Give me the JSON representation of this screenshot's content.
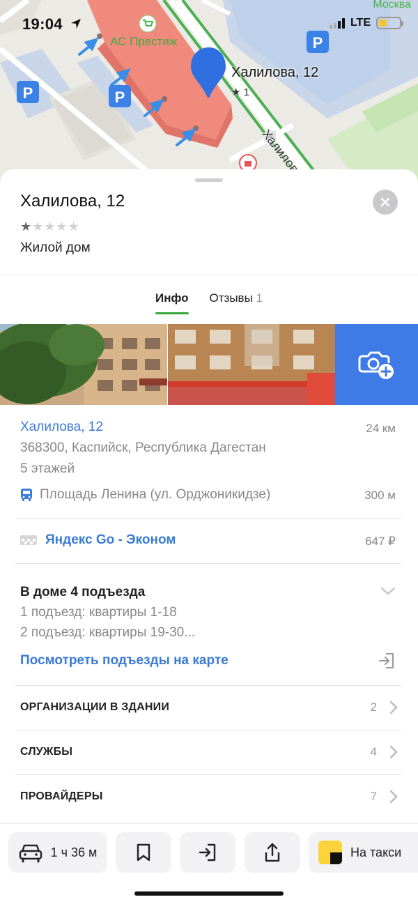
{
  "status_bar": {
    "time": "19:04",
    "network": "LTE"
  },
  "map": {
    "city_label": "Москва",
    "shop_label": "АС Престиж",
    "pin_label": "Халилова, 12",
    "pin_rating": "★ 1",
    "street_label": "Халилова",
    "parking_label": "P"
  },
  "place": {
    "title": "Халилова, 12",
    "rating_stars": 1,
    "rating_max": 5,
    "type": "Жилой дом"
  },
  "tabs": [
    {
      "label": "Инфо",
      "count": ""
    },
    {
      "label": "Отзывы",
      "count": "1"
    }
  ],
  "address": {
    "title": "Халилова, 12",
    "distance": "24 км",
    "line": "368300, Каспийск, Республика Дагестан",
    "floors": "5 этажей",
    "transit_stop": "Площадь Ленина (ул. Орджоникидзе)",
    "transit_distance": "300 м"
  },
  "taxi": {
    "label": "Яндекс Go - Эконом",
    "price": "647 ₽"
  },
  "entrances": {
    "title": "В доме 4 подъезда",
    "line1": "1 подъезд: квартиры 1-18",
    "line2": "2 подъезд: квартиры 19-30...",
    "link": "Посмотреть подъезды на карте"
  },
  "sections": [
    {
      "label": "ОРГАНИЗАЦИИ В ЗДАНИИ",
      "count": "2"
    },
    {
      "label": "СЛУЖБЫ",
      "count": "4"
    },
    {
      "label": "ПРОВАЙДЕРЫ",
      "count": "7"
    }
  ],
  "bottom_bar": {
    "route_time": "1 ч 36 м",
    "taxi_label": "На такси"
  },
  "colors": {
    "accent_blue": "#3a7bd5",
    "accent_green": "#3aa63a",
    "add_photo_bg": "#3e7be6",
    "building_highlight": "#f08a7c"
  }
}
